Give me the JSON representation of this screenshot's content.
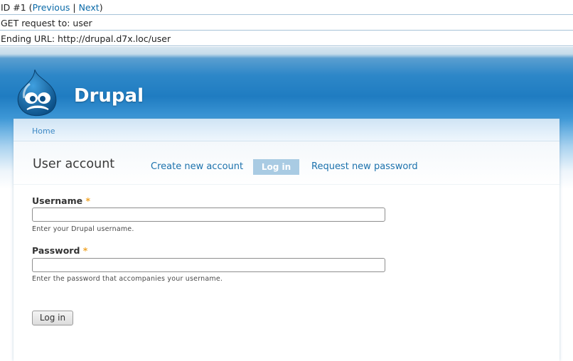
{
  "debug": {
    "id_prefix": "ID #1 (",
    "previous_label": "Previous",
    "separator": " | ",
    "next_label": "Next",
    "id_suffix": ")",
    "get_request": "GET request to: user",
    "ending_url": "Ending URL: http://drupal.d7x.loc/user"
  },
  "header": {
    "site_name": "Drupal",
    "logo_icon": "drupal-drop-logo-icon"
  },
  "breadcrumb": {
    "home_label": "Home"
  },
  "page": {
    "title": "User account",
    "tabs": [
      {
        "label": "Create new account",
        "active": false
      },
      {
        "label": "Log in",
        "active": true
      },
      {
        "label": "Request new password",
        "active": false
      }
    ]
  },
  "form": {
    "username": {
      "label": "Username",
      "required_marker": "*",
      "value": "",
      "description": "Enter your Drupal username."
    },
    "password": {
      "label": "Password",
      "required_marker": "*",
      "value": "",
      "description": "Enter the password that accompanies your username."
    },
    "submit_label": "Log in"
  },
  "colors": {
    "header_blue": "#1f7cc1",
    "link_blue": "#1c72ad",
    "active_tab_bg": "#a9cbe3",
    "required_marker": "#f0a52a"
  }
}
